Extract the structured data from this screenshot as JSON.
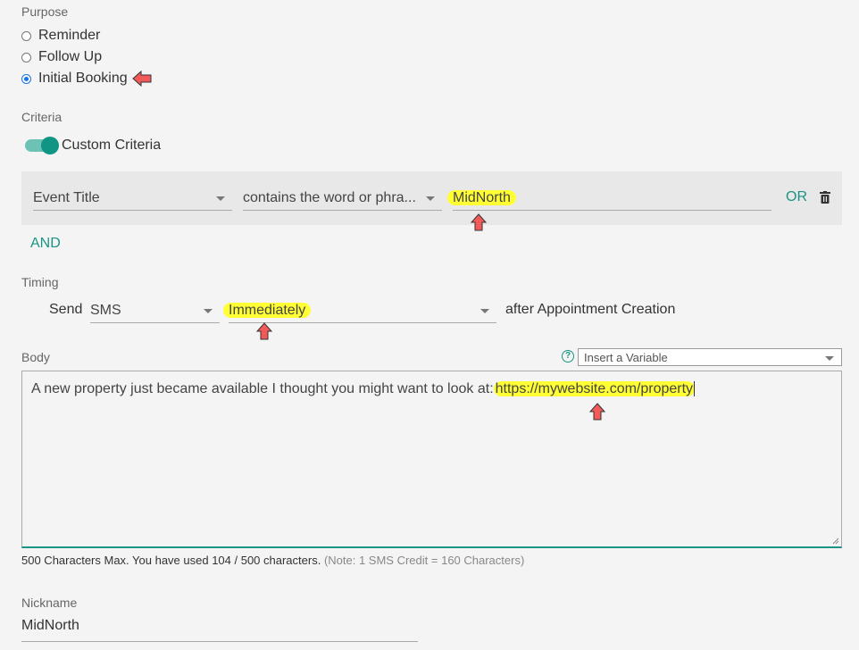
{
  "purpose": {
    "label": "Purpose",
    "options": [
      "Reminder",
      "Follow Up",
      "Initial Booking"
    ],
    "selected": "Initial Booking"
  },
  "criteria": {
    "label": "Criteria",
    "toggle_label": "Custom Criteria",
    "toggle_on": true,
    "field": "Event Title",
    "operator": "contains the word or phra...",
    "value": "MidNorth",
    "or_label": "OR",
    "and_label": "AND"
  },
  "timing": {
    "label": "Timing",
    "send_label": "Send",
    "channel": "SMS",
    "when": "Immediately",
    "suffix": "after Appointment Creation"
  },
  "body": {
    "label": "Body",
    "insert_variable_placeholder": "Insert a Variable",
    "text_prefix": "A new property just became available I thought you might want to look at:",
    "text_link": "https://mywebsite.com/property",
    "counter_main": "500 Characters Max. You have used 104 / 500 characters.",
    "counter_note": "(Note: 1 SMS Credit = 160 Characters)"
  },
  "nickname": {
    "label": "Nickname",
    "value": "MidNorth"
  },
  "colors": {
    "accent": "#1c9484",
    "highlight": "#ffff33",
    "arrow": "#f25a5a"
  },
  "icons": [
    "red-arrow-marker-icon",
    "trash-icon",
    "help-icon",
    "chevron-down-icon"
  ]
}
